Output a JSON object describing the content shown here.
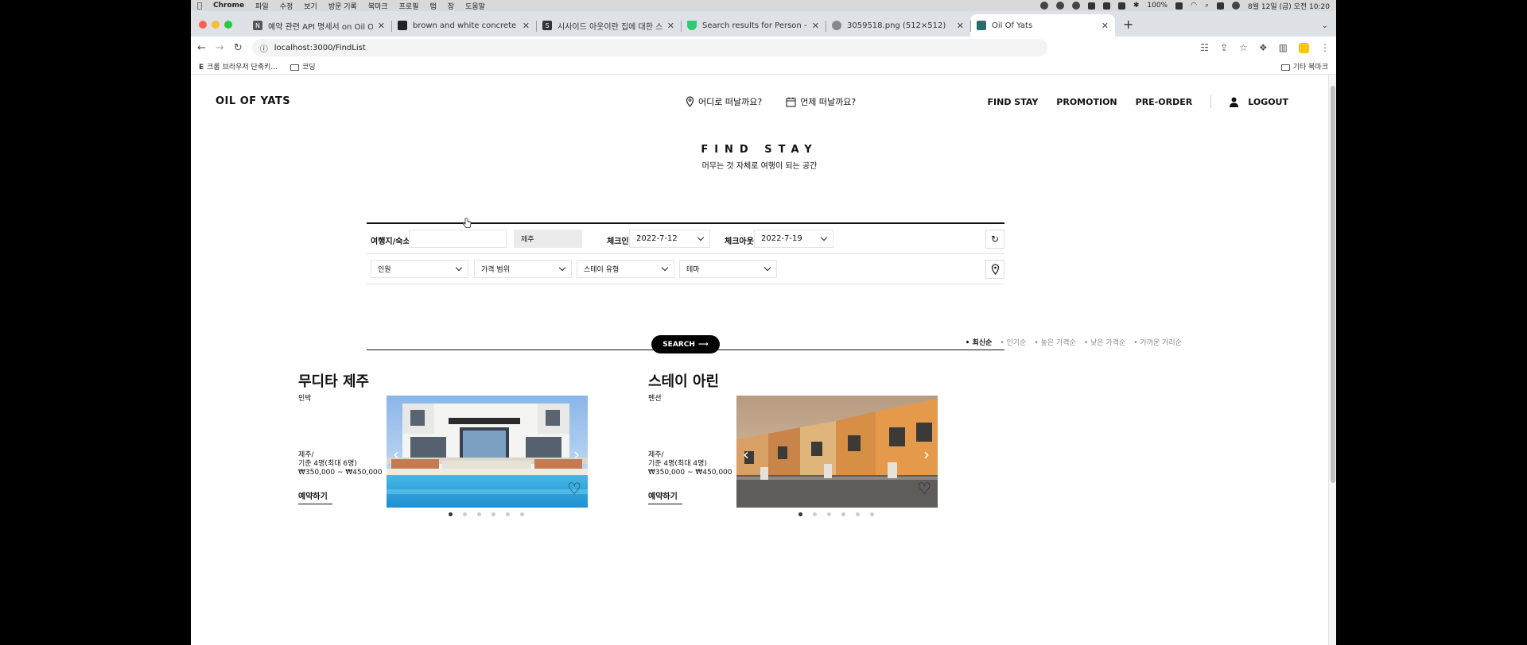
{
  "menubar": {
    "app": "Chrome",
    "items": [
      "파일",
      "수정",
      "보기",
      "방문 기록",
      "북마크",
      "프로필",
      "탭",
      "창",
      "도움말"
    ],
    "battery": "100%",
    "clock": "8월 12일 (금) 오전 10:20"
  },
  "tabs": [
    {
      "title": "예약 관련 API 명세서 on Oil Of Yats"
    },
    {
      "title": "brown and white concrete hou"
    },
    {
      "title": "시사이드 아웃이란 집에 대한 스톡 사"
    },
    {
      "title": "Search results for Person - Fla"
    },
    {
      "title": "3059518.png (512×512)"
    },
    {
      "title": "Oil Of Yats"
    }
  ],
  "address": {
    "url": "localhost:3000/FindList"
  },
  "bookmarks": {
    "items": [
      "크롬 브라우저 단축키...",
      "코딩"
    ],
    "other": "기타 북마크"
  },
  "header": {
    "logo": "OIL OF YATS",
    "where": "어디로 떠날까요?",
    "when": "언제 떠날까요?",
    "nav": [
      "FIND STAY",
      "PROMOTION",
      "PRE-ORDER"
    ],
    "logout": "LOGOUT"
  },
  "hero": {
    "title": "FIND STAY",
    "subtitle": "머무는 것 자체로 여행이 되는 공간"
  },
  "search": {
    "dest_label": "여행지/숙소",
    "dest_value": "",
    "region": "제주",
    "checkin_label": "체크인",
    "checkin": "2022-7-12",
    "checkout_label": "체크아웃",
    "checkout": "2022-7-19",
    "people": "인원",
    "price": "가격 범위",
    "staytype": "스테이 유형",
    "theme": "테마",
    "button": "SEARCH"
  },
  "sort": {
    "options": [
      "최신순",
      "인기순",
      "높은 가격순",
      "낮은 가격순",
      "가까운 거리순"
    ],
    "active": 0
  },
  "stays": [
    {
      "name": "무디타 제주",
      "type": "민박",
      "region": "제주/",
      "capacity": "기준 4명(최대 6명)",
      "price": "₩350,000 ~ ₩450,000",
      "cta": "예약하기",
      "slides": 6,
      "active_slide": 0
    },
    {
      "name": "스테이 아린",
      "type": "펜션",
      "region": "제주/",
      "capacity": "기준 4명(최대 4명)",
      "price": "₩350,000 ~ ₩450,000",
      "cta": "예약하기",
      "slides": 6,
      "active_slide": 0
    }
  ],
  "colors": {
    "accent": "#000000",
    "muted": "#888888",
    "input_grey": "#ebebeb"
  }
}
